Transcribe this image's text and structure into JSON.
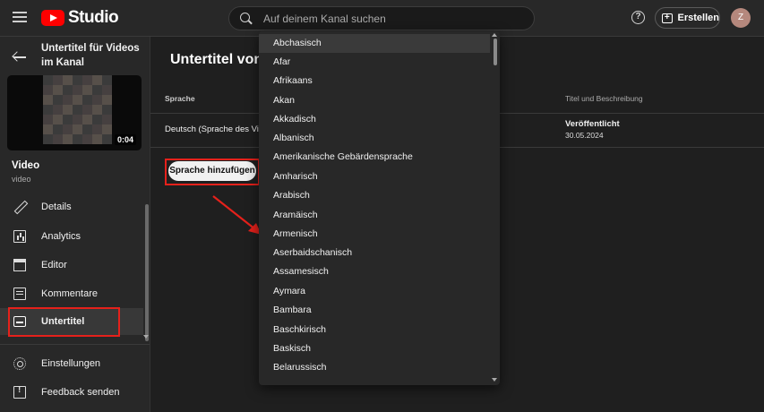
{
  "header": {
    "logo_text": "Studio",
    "search_placeholder": "Auf deinem Kanal suchen",
    "help_symbol": "?",
    "create_label": "Erstellen",
    "avatar_initial": "Z"
  },
  "sidebar": {
    "title": "Untertitel für Videos im Kanal",
    "video_duration": "0:04",
    "video_title": "Video",
    "video_subtitle": "video",
    "items": [
      {
        "label": "Details",
        "icon": "pencil-icon"
      },
      {
        "label": "Analytics",
        "icon": "analytics-icon"
      },
      {
        "label": "Editor",
        "icon": "editor-icon"
      },
      {
        "label": "Kommentare",
        "icon": "comments-icon"
      },
      {
        "label": "Untertitel",
        "icon": "subtitles-icon",
        "active": true
      }
    ],
    "footer_items": [
      {
        "label": "Einstellungen",
        "icon": "gear-icon"
      },
      {
        "label": "Feedback senden",
        "icon": "feedback-icon"
      }
    ]
  },
  "main": {
    "page_title": "Untertitel von",
    "columns": {
      "language": "Sprache",
      "title_description": "Titel und Beschreibung"
    },
    "rows": [
      {
        "language": "Deutsch (Sprache des Video",
        "status": "Veröffentlicht",
        "date": "30.05.2024"
      }
    ],
    "add_language_button": "Sprache hinzufügen"
  },
  "dropdown": {
    "selected": "Abchasisch",
    "options": [
      "Abchasisch",
      "Afar",
      "Afrikaans",
      "Akan",
      "Akkadisch",
      "Albanisch",
      "Amerikanische Gebärdensprache",
      "Amharisch",
      "Arabisch",
      "Aramäisch",
      "Armenisch",
      "Aserbaidschanisch",
      "Assamesisch",
      "Aymara",
      "Bambara",
      "Baschkirisch",
      "Baskisch",
      "Belarussisch"
    ]
  },
  "colors": {
    "background": "#1f1f1f",
    "surface": "#282828",
    "brand_red": "#ff0000",
    "annotation_red": "#e5211b"
  }
}
